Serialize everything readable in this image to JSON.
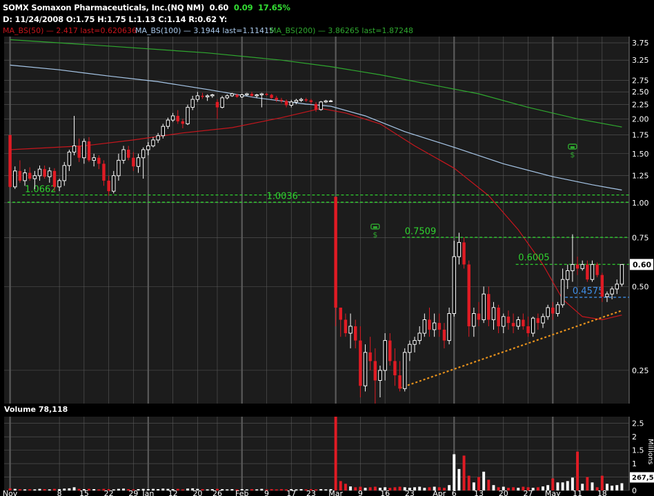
{
  "header": {
    "symbol_line": "SOMX Somaxon Pharmaceuticals, Inc.(NQ NM)",
    "last": "0.60",
    "change": "0.09",
    "change_pct": "17.65%",
    "ohlc_line": "D:  11/24/2008 O:1.75  H:1.75  L:1.13  C:1.14  R:0.62  Y:",
    "ma50": "MA_BS(50) — 2.417 last=0.620636",
    "ma100": "MA_BS(100) — 3.1944 last=1.11415",
    "ma200": "MA_BS(200) — 3.86265 last=1.87248",
    "volume_label": "Volume 78,118",
    "millions_label": "Millions"
  },
  "colors": {
    "background": "#000000",
    "panel": "#1c1c1c",
    "grid": "#5a5a5a",
    "up_candle": "#ffffff",
    "down_candle": "#e01b24",
    "ma50": "#c8161d",
    "ma100": "#a8c8ea",
    "ma200": "#2fa82f",
    "level_line": "#2fd22f",
    "support_line": "#e8921c",
    "blue_level": "#3f8fe8"
  },
  "chart_data": {
    "type": "candlestick",
    "title": "SOMX Somaxon Pharmaceuticals, Inc.(NQ NM)",
    "y_scale": "log",
    "ylim": [
      0.19,
      3.95
    ],
    "y_ticks": [
      "3.75",
      "3.25",
      "2.75",
      "2.50",
      "2.25",
      "2.00",
      "1.75",
      "1.50",
      "1.25",
      "1.00",
      "0.75",
      "0.50",
      "0.25"
    ],
    "y_tick_values": [
      3.75,
      3.25,
      2.75,
      2.5,
      2.25,
      2.0,
      1.75,
      1.5,
      1.25,
      1.0,
      0.75,
      0.5,
      0.25
    ],
    "x_ticks": [
      {
        "label": "Nov",
        "i": 0
      },
      {
        "label": "8",
        "i": 10
      },
      {
        "label": "15",
        "i": 15
      },
      {
        "label": "22",
        "i": 20
      },
      {
        "label": "29",
        "i": 25
      },
      {
        "label": "Jan",
        "i": 28
      },
      {
        "label": "12",
        "i": 33
      },
      {
        "label": "20",
        "i": 38
      },
      {
        "label": "26",
        "i": 42
      },
      {
        "label": "Feb",
        "i": 47
      },
      {
        "label": "9",
        "i": 52
      },
      {
        "label": "17",
        "i": 57
      },
      {
        "label": "23",
        "i": 61
      },
      {
        "label": "Mar",
        "i": 66
      },
      {
        "label": "9",
        "i": 71
      },
      {
        "label": "16",
        "i": 76
      },
      {
        "label": "23",
        "i": 81
      },
      {
        "label": "Apr",
        "i": 87
      },
      {
        "label": "6",
        "i": 90
      },
      {
        "label": "13",
        "i": 95
      },
      {
        "label": "20",
        "i": 100
      },
      {
        "label": "27",
        "i": 105
      },
      {
        "label": "May",
        "i": 110
      },
      {
        "label": "11",
        "i": 115
      },
      {
        "label": "18",
        "i": 120
      }
    ],
    "major_grid_i": [
      0,
      28,
      47,
      66,
      90,
      110
    ],
    "candles": [
      [
        1.75,
        1.75,
        1.13,
        1.14
      ],
      [
        1.14,
        1.35,
        1.12,
        1.3
      ],
      [
        1.3,
        1.42,
        1.18,
        1.2
      ],
      [
        1.2,
        1.32,
        1.15,
        1.28
      ],
      [
        1.28,
        1.34,
        1.2,
        1.22
      ],
      [
        1.22,
        1.3,
        1.12,
        1.25
      ],
      [
        1.25,
        1.36,
        1.2,
        1.32
      ],
      [
        1.32,
        1.36,
        1.22,
        1.24
      ],
      [
        1.24,
        1.34,
        1.18,
        1.3
      ],
      [
        1.3,
        1.33,
        1.1,
        1.14
      ],
      [
        1.14,
        1.22,
        1.1,
        1.2
      ],
      [
        1.2,
        1.4,
        1.15,
        1.36
      ],
      [
        1.36,
        1.55,
        1.3,
        1.52
      ],
      [
        1.52,
        2.05,
        1.48,
        1.6
      ],
      [
        1.6,
        1.7,
        1.4,
        1.45
      ],
      [
        1.45,
        1.7,
        1.38,
        1.66
      ],
      [
        1.66,
        1.72,
        1.4,
        1.42
      ],
      [
        1.42,
        1.5,
        1.35,
        1.45
      ],
      [
        1.45,
        1.48,
        1.32,
        1.38
      ],
      [
        1.38,
        1.42,
        1.15,
        1.2
      ],
      [
        1.2,
        1.25,
        1.06,
        1.1
      ],
      [
        1.1,
        1.3,
        1.08,
        1.25
      ],
      [
        1.25,
        1.5,
        1.2,
        1.42
      ],
      [
        1.42,
        1.6,
        1.38,
        1.55
      ],
      [
        1.55,
        1.6,
        1.42,
        1.45
      ],
      [
        1.45,
        1.52,
        1.3,
        1.35
      ],
      [
        1.35,
        1.5,
        1.28,
        1.45
      ],
      [
        1.45,
        1.58,
        1.22,
        1.55
      ],
      [
        1.55,
        1.65,
        1.48,
        1.6
      ],
      [
        1.6,
        1.72,
        1.58,
        1.68
      ],
      [
        1.68,
        1.78,
        1.64,
        1.74
      ],
      [
        1.74,
        1.92,
        1.7,
        1.88
      ],
      [
        1.88,
        2.02,
        1.84,
        1.98
      ],
      [
        1.98,
        2.1,
        1.95,
        2.05
      ],
      [
        2.05,
        2.15,
        1.92,
        1.96
      ],
      [
        1.96,
        2.0,
        1.85,
        1.92
      ],
      [
        1.92,
        2.25,
        1.9,
        2.2
      ],
      [
        2.2,
        2.42,
        2.15,
        2.35
      ],
      [
        2.35,
        2.5,
        2.3,
        2.42
      ],
      [
        2.42,
        2.48,
        2.36,
        2.4
      ],
      [
        2.4,
        2.45,
        2.32,
        2.42
      ],
      [
        2.42,
        2.46,
        2.38,
        2.44
      ],
      [
        2.3,
        2.35,
        2.0,
        2.2
      ],
      [
        2.2,
        2.42,
        2.18,
        2.38
      ],
      [
        2.38,
        2.45,
        2.35,
        2.42
      ],
      [
        2.42,
        2.48,
        2.4,
        2.46
      ],
      [
        2.44,
        2.46,
        2.38,
        2.4
      ],
      [
        2.4,
        2.46,
        2.38,
        2.44
      ],
      [
        2.44,
        2.48,
        2.42,
        2.46
      ],
      [
        2.46,
        2.5,
        2.4,
        2.42
      ],
      [
        2.42,
        2.46,
        2.38,
        2.44
      ],
      [
        2.44,
        2.48,
        2.2,
        2.46
      ],
      [
        2.46,
        2.48,
        2.42,
        2.44
      ],
      [
        2.44,
        2.46,
        2.36,
        2.38
      ],
      [
        2.38,
        2.42,
        2.3,
        2.34
      ],
      [
        2.34,
        2.38,
        2.28,
        2.32
      ],
      [
        2.32,
        2.35,
        2.2,
        2.24
      ],
      [
        2.24,
        2.34,
        2.2,
        2.3
      ],
      [
        2.3,
        2.36,
        2.26,
        2.33
      ],
      [
        2.33,
        2.38,
        2.3,
        2.35
      ],
      [
        2.35,
        2.38,
        2.3,
        2.33
      ],
      [
        2.33,
        2.36,
        2.26,
        2.3
      ],
      [
        2.26,
        2.3,
        2.12,
        2.16
      ],
      [
        2.16,
        2.32,
        2.14,
        2.3
      ],
      [
        2.3,
        2.34,
        2.28,
        2.32
      ],
      [
        2.32,
        2.34,
        2.3,
        2.32
      ],
      [
        1.05,
        1.05,
        0.36,
        0.42
      ],
      [
        0.42,
        0.42,
        0.33,
        0.38
      ],
      [
        0.38,
        0.4,
        0.33,
        0.34
      ],
      [
        0.34,
        0.4,
        0.3,
        0.36
      ],
      [
        0.36,
        0.38,
        0.3,
        0.32
      ],
      [
        0.32,
        0.36,
        0.2,
        0.22
      ],
      [
        0.22,
        0.31,
        0.21,
        0.29
      ],
      [
        0.29,
        0.33,
        0.25,
        0.27
      ],
      [
        0.27,
        0.3,
        0.19,
        0.23
      ],
      [
        0.23,
        0.26,
        0.2,
        0.25
      ],
      [
        0.25,
        0.34,
        0.23,
        0.32
      ],
      [
        0.32,
        0.34,
        0.26,
        0.27
      ],
      [
        0.27,
        0.3,
        0.22,
        0.24
      ],
      [
        0.24,
        0.27,
        0.21,
        0.215
      ],
      [
        0.215,
        0.3,
        0.21,
        0.29
      ],
      [
        0.29,
        0.32,
        0.27,
        0.31
      ],
      [
        0.31,
        0.33,
        0.29,
        0.32
      ],
      [
        0.32,
        0.36,
        0.31,
        0.34
      ],
      [
        0.34,
        0.4,
        0.33,
        0.38
      ],
      [
        0.38,
        0.42,
        0.33,
        0.35
      ],
      [
        0.35,
        0.4,
        0.33,
        0.37
      ],
      [
        0.37,
        0.4,
        0.33,
        0.35
      ],
      [
        0.35,
        0.37,
        0.3,
        0.32
      ],
      [
        0.32,
        0.42,
        0.31,
        0.4
      ],
      [
        0.4,
        0.73,
        0.39,
        0.64
      ],
      [
        0.64,
        0.78,
        0.6,
        0.72
      ],
      [
        0.72,
        0.75,
        0.58,
        0.6
      ],
      [
        0.6,
        0.62,
        0.33,
        0.36
      ],
      [
        0.36,
        0.42,
        0.33,
        0.4
      ],
      [
        0.4,
        0.44,
        0.36,
        0.38
      ],
      [
        0.38,
        0.5,
        0.37,
        0.47
      ],
      [
        0.47,
        0.5,
        0.36,
        0.38
      ],
      [
        0.38,
        0.44,
        0.35,
        0.42
      ],
      [
        0.42,
        0.43,
        0.34,
        0.36
      ],
      [
        0.36,
        0.4,
        0.34,
        0.39
      ],
      [
        0.39,
        0.41,
        0.35,
        0.37
      ],
      [
        0.37,
        0.4,
        0.34,
        0.36
      ],
      [
        0.36,
        0.39,
        0.35,
        0.38
      ],
      [
        0.38,
        0.4,
        0.35,
        0.36
      ],
      [
        0.36,
        0.39,
        0.33,
        0.34
      ],
      [
        0.34,
        0.39,
        0.33,
        0.385
      ],
      [
        0.385,
        0.4,
        0.35,
        0.37
      ],
      [
        0.37,
        0.4,
        0.355,
        0.39
      ],
      [
        0.39,
        0.43,
        0.38,
        0.42
      ],
      [
        0.42,
        0.44,
        0.38,
        0.4
      ],
      [
        0.4,
        0.44,
        0.39,
        0.43
      ],
      [
        0.43,
        0.58,
        0.42,
        0.53
      ],
      [
        0.53,
        0.6,
        0.49,
        0.57
      ],
      [
        0.57,
        0.77,
        0.52,
        0.6
      ],
      [
        0.6,
        0.64,
        0.55,
        0.58
      ],
      [
        0.58,
        0.62,
        0.57,
        0.6
      ],
      [
        0.6,
        0.62,
        0.52,
        0.53
      ],
      [
        0.53,
        0.62,
        0.52,
        0.6
      ],
      [
        0.6,
        0.61,
        0.54,
        0.55
      ],
      [
        0.55,
        0.56,
        0.44,
        0.46
      ],
      [
        0.46,
        0.48,
        0.44,
        0.47
      ],
      [
        0.47,
        0.5,
        0.45,
        0.49
      ],
      [
        0.49,
        0.53,
        0.47,
        0.51
      ],
      [
        0.51,
        0.6,
        0.5,
        0.6
      ]
    ],
    "series": [
      {
        "name": "MA_BS(50)",
        "points": [
          [
            0,
            1.55
          ],
          [
            15,
            1.6
          ],
          [
            25,
            1.68
          ],
          [
            35,
            1.78
          ],
          [
            45,
            1.86
          ],
          [
            55,
            2.02
          ],
          [
            63,
            2.18
          ],
          [
            68,
            2.1
          ],
          [
            75,
            1.92
          ],
          [
            82,
            1.6
          ],
          [
            90,
            1.33
          ],
          [
            97,
            1.06
          ],
          [
            103,
            0.8
          ],
          [
            108,
            0.6
          ],
          [
            112,
            0.45
          ],
          [
            116,
            0.39
          ],
          [
            120,
            0.38
          ],
          [
            124,
            0.395
          ]
        ]
      },
      {
        "name": "MA_BS(100)",
        "points": [
          [
            0,
            3.12
          ],
          [
            10,
            3.0
          ],
          [
            20,
            2.85
          ],
          [
            30,
            2.72
          ],
          [
            40,
            2.55
          ],
          [
            50,
            2.38
          ],
          [
            60,
            2.26
          ],
          [
            65,
            2.22
          ],
          [
            72,
            2.05
          ],
          [
            80,
            1.8
          ],
          [
            90,
            1.58
          ],
          [
            100,
            1.38
          ],
          [
            110,
            1.24
          ],
          [
            118,
            1.16
          ],
          [
            124,
            1.11
          ]
        ]
      },
      {
        "name": "MA_BS(200)",
        "points": [
          [
            0,
            3.85
          ],
          [
            20,
            3.65
          ],
          [
            40,
            3.45
          ],
          [
            55,
            3.25
          ],
          [
            65,
            3.08
          ],
          [
            75,
            2.88
          ],
          [
            85,
            2.66
          ],
          [
            95,
            2.46
          ],
          [
            105,
            2.2
          ],
          [
            115,
            2.0
          ],
          [
            124,
            1.87
          ]
        ]
      }
    ],
    "levels": [
      {
        "label": "1.0662",
        "value": 1.0662,
        "from_i": 3,
        "to_i": 126,
        "color": "#2fd22f"
      },
      {
        "label": "1.0036",
        "value": 1.0036,
        "from_i": 0,
        "to_i": 126,
        "color": "#2fd22f"
      },
      {
        "label": "0.7509",
        "value": 0.7509,
        "from_i": 80,
        "to_i": 126,
        "color": "#2fd22f"
      },
      {
        "label": "0.6005",
        "value": 0.6005,
        "from_i": 103,
        "to_i": 126,
        "color": "#2fd22f"
      },
      {
        "label": "0.4575",
        "value": 0.4575,
        "from_i": 113,
        "to_i": 126,
        "color": "#3f8fe8"
      }
    ],
    "level_label_pos": [
      {
        "i": 3,
        "v": 1.09
      },
      {
        "i": 52,
        "v": 1.03
      },
      {
        "i": 80,
        "v": 0.77
      },
      {
        "i": 103,
        "v": 0.62
      },
      {
        "i": 114,
        "v": 0.47
      }
    ],
    "support_line": {
      "from": [
        79,
        0.216
      ],
      "to": [
        124,
        0.41
      ]
    },
    "event_icons": [
      {
        "i": 74,
        "v": 0.8
      },
      {
        "i": 114,
        "v": 1.55
      }
    ],
    "last_price_label": "0.60",
    "volume": {
      "y_ticks": [
        "2.5",
        "2",
        "1.5",
        "1",
        "0.5",
        "0"
      ],
      "y_tick_values": [
        2.5,
        2.0,
        1.5,
        1.0,
        0.5,
        0.0
      ],
      "ylim": [
        0,
        2.75
      ],
      "last_label": "267,5",
      "values": [
        0.08,
        0.06,
        0.05,
        0.04,
        0.05,
        0.04,
        0.06,
        0.05,
        0.04,
        0.06,
        0.05,
        0.07,
        0.08,
        0.12,
        0.06,
        0.05,
        0.06,
        0.05,
        0.04,
        0.06,
        0.05,
        0.04,
        0.06,
        0.07,
        0.05,
        0.04,
        0.05,
        0.06,
        0.05,
        0.06,
        0.05,
        0.07,
        0.06,
        0.05,
        0.06,
        0.04,
        0.07,
        0.08,
        0.06,
        0.05,
        0.04,
        0.05,
        0.06,
        0.05,
        0.04,
        0.05,
        0.04,
        0.05,
        0.04,
        0.05,
        0.04,
        0.06,
        0.04,
        0.05,
        0.04,
        0.05,
        0.04,
        0.05,
        0.04,
        0.05,
        0.04,
        0.05,
        0.04,
        0.05,
        0.04,
        0.05,
        2.75,
        0.35,
        0.25,
        0.15,
        0.12,
        0.14,
        0.1,
        0.12,
        0.14,
        0.1,
        0.12,
        0.1,
        0.12,
        0.14,
        0.12,
        0.1,
        0.12,
        0.14,
        0.1,
        0.12,
        0.14,
        0.12,
        0.1,
        0.2,
        1.35,
        0.8,
        1.3,
        0.55,
        0.3,
        0.5,
        0.7,
        0.4,
        0.2,
        0.12,
        0.14,
        0.1,
        0.12,
        0.1,
        0.14,
        0.12,
        0.1,
        0.12,
        0.15,
        0.2,
        0.45,
        0.3,
        0.3,
        0.35,
        0.48,
        1.45,
        0.25,
        0.5,
        0.3,
        0.12,
        0.55,
        0.25,
        0.18,
        0.2,
        0.27
      ]
    }
  }
}
